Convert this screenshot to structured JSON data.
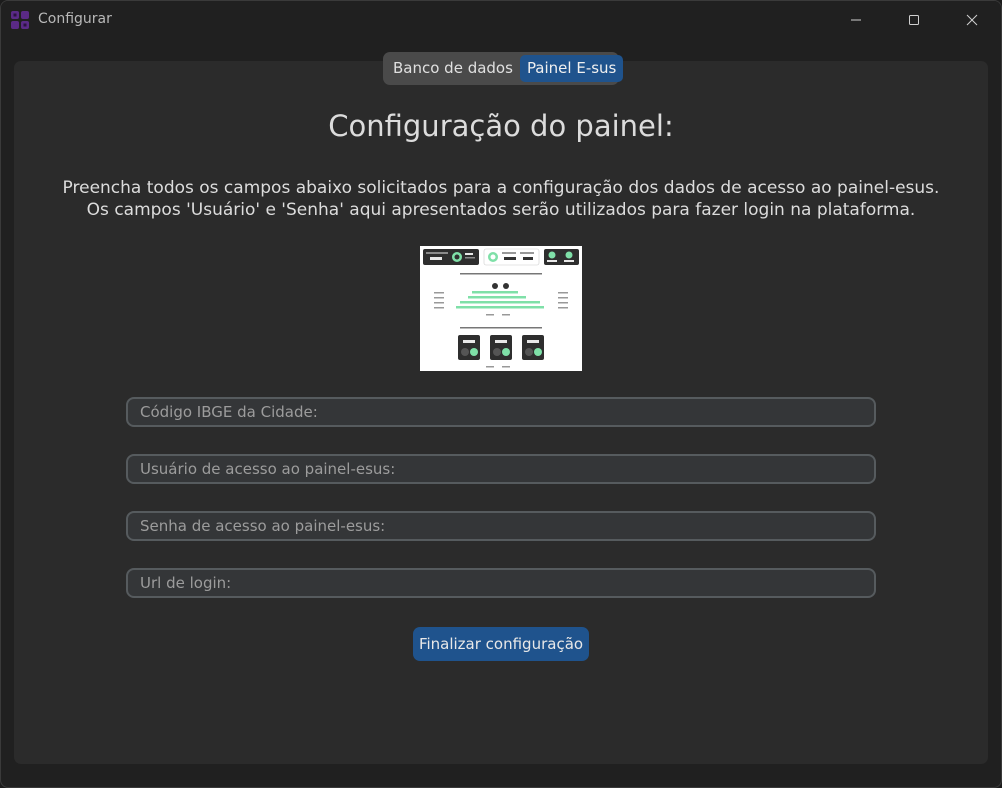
{
  "window": {
    "title": "Configurar",
    "app_icon": "grid-app-icon",
    "controls": [
      "minimize-icon",
      "maximize-icon",
      "close-icon"
    ]
  },
  "tabs": [
    {
      "label": "Banco de dados",
      "active": false
    },
    {
      "label": "Painel E-sus",
      "active": true
    }
  ],
  "main": {
    "heading": "Configuração do painel:",
    "description_line1": "Preencha todos os campos abaixo solicitados para a configuração dos dados de acesso ao painel-esus.",
    "description_line2": "Os campos 'Usuário' e 'Senha' aqui apresentados serão utilizados para fazer login na plataforma.",
    "preview_image": "painel-esus-dashboard-screenshot"
  },
  "form": {
    "ibge_placeholder": "Código IBGE da Cidade:",
    "user_placeholder": "Usuário de acesso ao painel-esus:",
    "password_placeholder": "Senha de acesso ao painel-esus:",
    "url_placeholder": "Url de login:",
    "submit_label": "Finalizar configuração"
  },
  "colors": {
    "accent": "#1f538d",
    "background": "#202020",
    "panel": "#2b2b2b",
    "field_bg": "#343638",
    "field_border": "#565b5e"
  }
}
